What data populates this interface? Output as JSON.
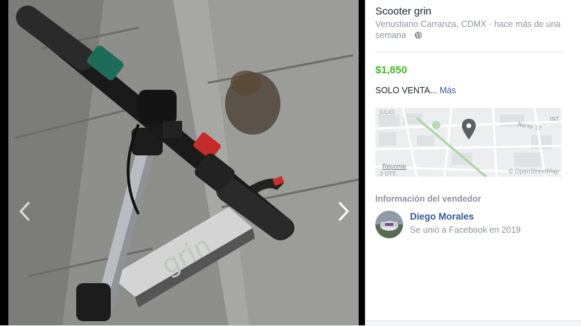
{
  "listing": {
    "title": "Scooter grin",
    "location_time": "Venustiano Carranza, CDMX · hace más de una semana ·",
    "price": "$1,850",
    "description": "SOLO VENTA...",
    "more_link": "Más"
  },
  "map": {
    "report_label": "Reportar",
    "attribution": "© OpenStreetMap",
    "street_labels": [
      "JULIO",
      "Norte 17",
      "INT",
      "3 OTE"
    ]
  },
  "seller": {
    "heading": "Información del vendedor",
    "name": "Diego Morales",
    "joined": "Se unió a Facebook en 2019"
  },
  "photo": {
    "brand_text": "grin",
    "prev_icon": "chevron-left-icon",
    "next_icon": "chevron-right-icon"
  },
  "colors": {
    "price": "#42b72a",
    "link": "#365899",
    "muted": "#90949c"
  }
}
